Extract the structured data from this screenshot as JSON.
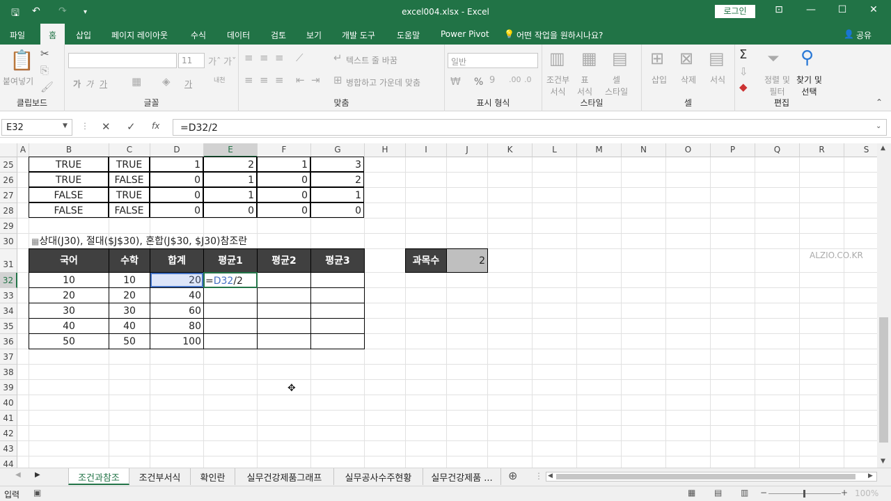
{
  "qat": {
    "save_icon": "save-icon",
    "undo_icon": "undo-icon",
    "redo_icon": "redo-icon"
  },
  "title": "excel004.xlsx  -  Excel",
  "login": "로그인",
  "tabs": [
    "파일",
    "홈",
    "삽입",
    "페이지 레이아웃",
    "수식",
    "데이터",
    "검토",
    "보기",
    "개발 도구",
    "도움말",
    "Power Pivot",
    "어떤 작업을 원하시나요?"
  ],
  "share": "공유",
  "ribbon": {
    "clipboard": {
      "paste": "붙여넣기",
      "label": "클립보드"
    },
    "font": {
      "size": "11",
      "bold": "가",
      "italic": "가",
      "underline": "가",
      "fontcolor": "가",
      "phonetic": "내천",
      "label": "글꼴"
    },
    "align": {
      "wrap": "텍스트 줄 바꿈",
      "merge": "병합하고 가운데 맞춤",
      "label": "맞춤"
    },
    "number": {
      "format": "일반",
      "percent": "%",
      "label": "표시 형식"
    },
    "style": {
      "cond": "조건부\n서식",
      "table": "표\n서식",
      "cell": "셀\n스타일",
      "label": "스타일"
    },
    "cells": {
      "insert": "삽입",
      "delete": "삭제",
      "format": "서식",
      "label": "셀"
    },
    "edit": {
      "sort": "정렬 및\n필터",
      "find": "찾기 및\n선택",
      "label": "편집"
    }
  },
  "namebox": "E32",
  "formula": "=D32/2",
  "fx": "fx",
  "columns": [
    "A",
    "B",
    "C",
    "D",
    "E",
    "F",
    "G",
    "H",
    "I",
    "J",
    "K",
    "L",
    "M",
    "N",
    "O",
    "P",
    "Q",
    "R",
    "S"
  ],
  "rows": [
    "25",
    "26",
    "27",
    "28",
    "29",
    "30",
    "31",
    "32",
    "33",
    "34",
    "35",
    "36",
    "37",
    "38",
    "39",
    "40",
    "41",
    "42",
    "43",
    "44"
  ],
  "table1": [
    [
      "TRUE",
      "TRUE",
      "1",
      "2",
      "1",
      "3"
    ],
    [
      "TRUE",
      "FALSE",
      "0",
      "1",
      "0",
      "2"
    ],
    [
      "FALSE",
      "TRUE",
      "0",
      "1",
      "0",
      "1"
    ],
    [
      "FALSE",
      "FALSE",
      "0",
      "0",
      "0",
      "0"
    ]
  ],
  "section_title": "상대(J30), 절대($J$30), 혼합(J$30, $J30)참조란",
  "table2_headers": [
    "국어",
    "수학",
    "합계",
    "평균1",
    "평균2",
    "평균3"
  ],
  "table2": [
    [
      "10",
      "10",
      "20"
    ],
    [
      "20",
      "20",
      "40"
    ],
    [
      "30",
      "30",
      "60"
    ],
    [
      "40",
      "40",
      "80"
    ],
    [
      "50",
      "50",
      "100"
    ]
  ],
  "edit_cell": {
    "eq": "=",
    "ref": "D32",
    "rest": "/2"
  },
  "subjects": {
    "label": "과목수",
    "value": "2"
  },
  "watermark": "ALZIO.CO.KR",
  "sheets": [
    "조건과참조",
    "조건부서식",
    "확인란",
    "실무건강제품그래프",
    "실무공사수주현황",
    "실무건강제품 ..."
  ],
  "status": {
    "mode": "입력",
    "zoom": "100%"
  }
}
